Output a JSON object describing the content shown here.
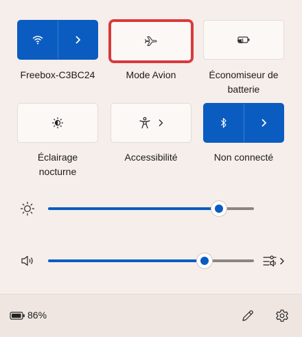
{
  "tiles": {
    "wifi": {
      "label": "Freebox-C3BC24",
      "state": "on",
      "icon": "wifi-icon"
    },
    "airplane": {
      "label": "Mode Avion",
      "state": "off",
      "icon": "airplane-icon"
    },
    "battery_saver": {
      "label": "Économiseur de batterie",
      "state": "off",
      "icon": "battery-saver-icon"
    },
    "night_light": {
      "label": "Éclairage nocturne",
      "state": "off",
      "icon": "night-light-icon"
    },
    "accessibility": {
      "label": "Accessibilité",
      "state": "off",
      "icon": "accessibility-icon"
    },
    "bluetooth": {
      "label": "Non connecté",
      "state": "on",
      "icon": "bluetooth-icon"
    }
  },
  "sliders": {
    "brightness": {
      "icon": "brightness-icon",
      "level_percent": 83
    },
    "volume": {
      "icon": "speaker-icon",
      "level_percent": 76
    }
  },
  "footer": {
    "battery_percent": "86%",
    "battery_icon": "battery-icon",
    "edit_icon": "pencil-icon",
    "settings_icon": "gear-icon"
  },
  "colors": {
    "accent": "#0b5cc0",
    "focus_outline": "#d9393b",
    "panel_bg": "#f6eeea"
  }
}
